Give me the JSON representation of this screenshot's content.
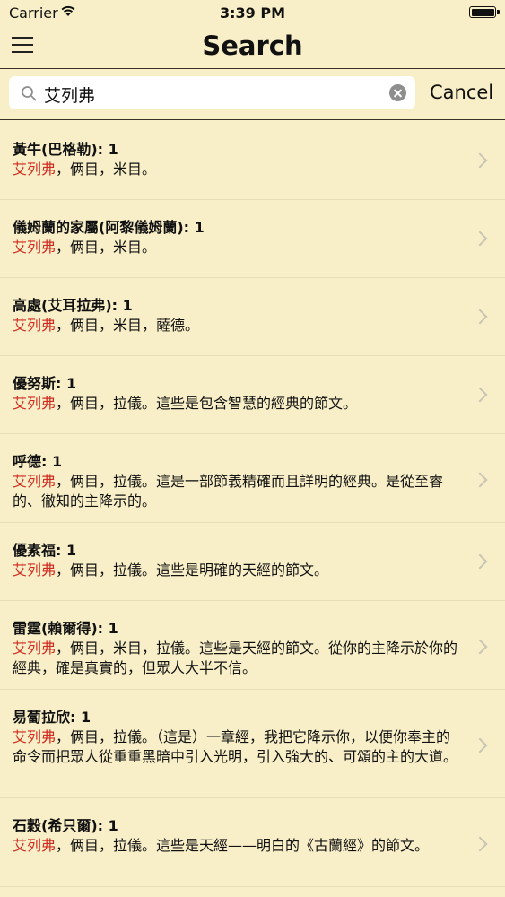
{
  "status_bar": {
    "carrier": "Carrier",
    "time": "3:39 PM"
  },
  "nav": {
    "title": "Search"
  },
  "search": {
    "query": "艾列弗",
    "cancel_label": "Cancel"
  },
  "results": [
    {
      "title": "黃牛(巴格勒): 1",
      "highlight": "艾列弗",
      "text": "，俩目，米目。"
    },
    {
      "title": "儀姆蘭的家屬(阿黎儀姆蘭): 1",
      "highlight": "艾列弗",
      "text": "，俩目，米目。"
    },
    {
      "title": "高處(艾耳拉弗): 1",
      "highlight": "艾列弗",
      "text": "，俩目，米目，薩德。"
    },
    {
      "title": "優努斯: 1",
      "highlight": "艾列弗",
      "text": "，俩目，拉儀。這些是包含智慧的經典的節文。"
    },
    {
      "title": "呼德: 1",
      "highlight": "艾列弗",
      "text": "，俩目，拉儀。這是一部節義精確而且詳明的經典。是從至睿的、徹知的主降示的。"
    },
    {
      "title": "優素福: 1",
      "highlight": "艾列弗",
      "text": "，俩目，拉儀。這些是明確的天經的節文。"
    },
    {
      "title": "雷霆(賴爾得): 1",
      "highlight": "艾列弗",
      "text": "，俩目，米目，拉儀。這些是天經的節文。從你的主降示於你的經典，確是真實的，但眾人大半不信。"
    },
    {
      "title": "易蔔拉欣: 1",
      "highlight": "艾列弗",
      "text": "，俩目，拉儀。（這是）一章經，我把它降示你，以便你奉主的命令而把眾人從重重黑暗中引入光明，引入強大的、可頌的主的大道。"
    },
    {
      "title": "石穀(希只爾): 1",
      "highlight": "艾列弗",
      "text": "，俩目，拉儀。這些是天經——明白的《古蘭經》的節文。"
    }
  ]
}
